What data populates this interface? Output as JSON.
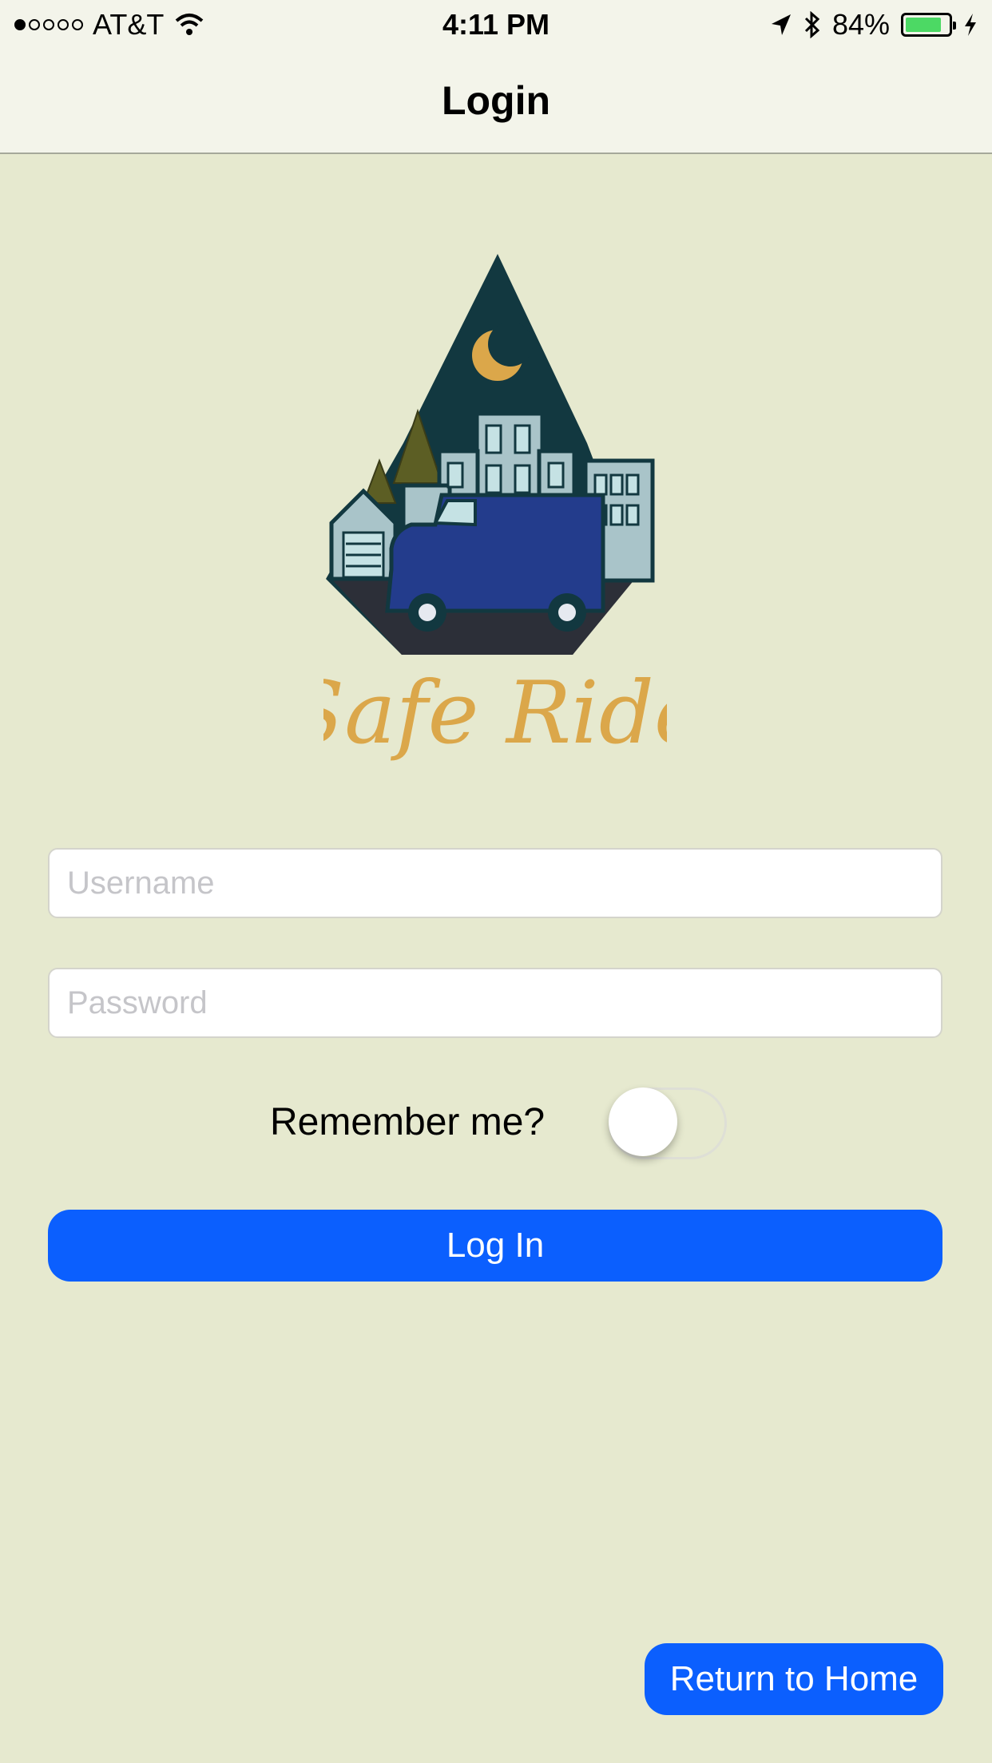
{
  "status_bar": {
    "carrier": "AT&T",
    "time": "4:11 PM",
    "battery": "84%",
    "battery_level": 0.84,
    "icons": [
      "signal-dots-icon",
      "wifi-icon",
      "location-arrow-icon",
      "bluetooth-icon",
      "battery-icon",
      "charging-icon"
    ]
  },
  "nav": {
    "title": "Login"
  },
  "logo": {
    "wordmark": "Safe Ride"
  },
  "form": {
    "username_placeholder": "Username",
    "username_value": "",
    "password_placeholder": "Password",
    "password_value": "",
    "remember_label": "Remember me?",
    "remember_on": false,
    "login_label": "Log In"
  },
  "footer": {
    "home_label": "Return to Home"
  },
  "colors": {
    "background": "#e6e9cf",
    "bar": "#f3f4ea",
    "accent": "#0b5ffe",
    "logo_gold": "#dba74a",
    "logo_teal": "#123840",
    "van_blue": "#233c8c"
  }
}
